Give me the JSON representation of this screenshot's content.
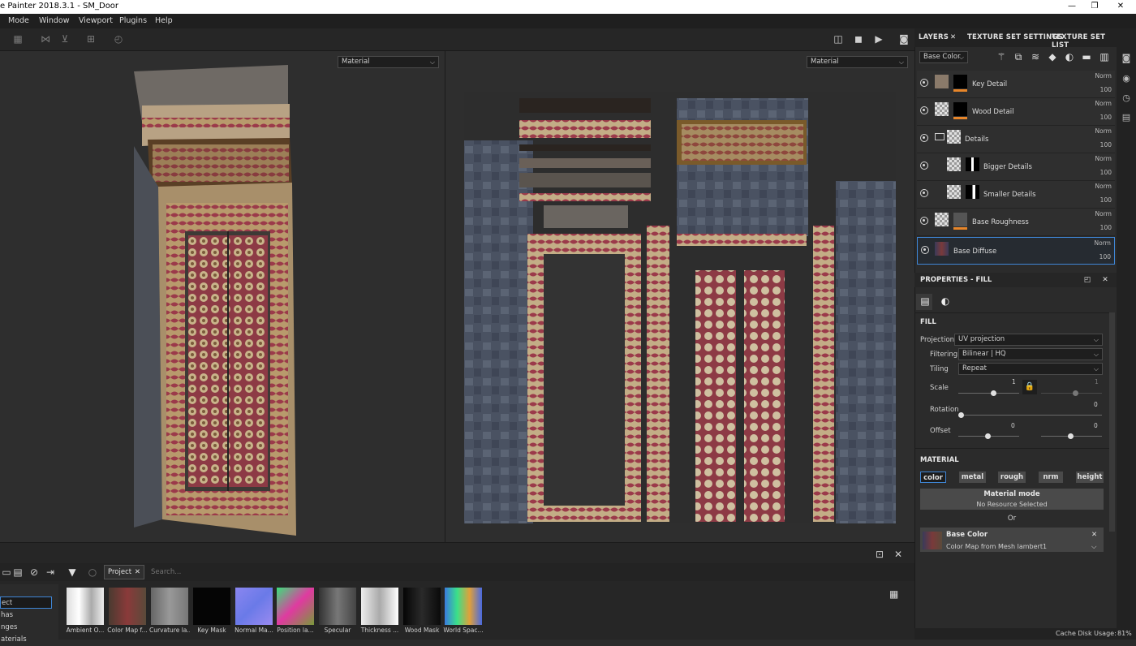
{
  "app": {
    "title": "e Painter 2018.3.1 - SM_Door"
  },
  "window_controls": [
    "—",
    "❐",
    "✕"
  ],
  "menu": [
    "Mode",
    "Window",
    "Viewport",
    "Plugins",
    "Help"
  ],
  "viewport": {
    "left_mode": "Material",
    "right_mode": "Material"
  },
  "right_tabs": {
    "layers": "LAYERS",
    "close": "✕",
    "texture_set_settings": "TEXTURE SET SETTINGS",
    "texture_set_list": "TEXTURE SET LIST"
  },
  "layers_toolbar": {
    "channel": "Base Color"
  },
  "layers": [
    {
      "name": "Key Detail",
      "blend": "Norm",
      "opacity": "100"
    },
    {
      "name": "Wood Detail",
      "blend": "Norm",
      "opacity": "100"
    },
    {
      "name": "Details",
      "blend": "Norm",
      "opacity": "100"
    },
    {
      "name": "Bigger Details",
      "blend": "Norm",
      "opacity": "100"
    },
    {
      "name": "Smaller Details",
      "blend": "Norm",
      "opacity": "100"
    },
    {
      "name": "Base Roughness",
      "blend": "Norm",
      "opacity": "100"
    },
    {
      "name": "Base Diffuse",
      "blend": "Norm",
      "opacity": "100"
    }
  ],
  "properties": {
    "title": "PROPERTIES - FILL",
    "fill_header": "FILL",
    "projection_label": "Projection",
    "projection_value": "UV projection",
    "filtering_label": "Filtering",
    "filtering_value": "Bilinear | HQ",
    "tiling_label": "Tiling",
    "tiling_value": "Repeat",
    "scale_label": "Scale",
    "scale_value": "1",
    "scale_value2": "1",
    "rotation_label": "Rotation",
    "rotation_value": "0",
    "offset_label": "Offset",
    "offset_x": "0",
    "offset_y": "0",
    "material_header": "MATERIAL",
    "channels": [
      "color",
      "metal",
      "rough",
      "nrm",
      "height"
    ],
    "material_mode_title": "Material mode",
    "material_mode_value": "No Resource Selected",
    "or_label": "Or",
    "base_color_title": "Base Color",
    "base_color_sub": "Color Map from Mesh lambert1"
  },
  "shelf": {
    "project_tab": "Project",
    "search_placeholder": "Search...",
    "left_items": [
      "ect",
      "has",
      "nges",
      "aterials"
    ],
    "thumbnails": [
      "Ambient O...",
      "Color Map f...",
      "Curvature la...",
      "Key Mask",
      "Normal Ma...",
      "Position la...",
      "Specular",
      "Thickness ...",
      "Wood Mask",
      "World Spac..."
    ]
  },
  "status": {
    "cache": "Cache Disk Usage:",
    "cache_value": "81%"
  },
  "colors": {
    "accent": "#3f86d6",
    "opacity_bar": "#e8862a"
  }
}
